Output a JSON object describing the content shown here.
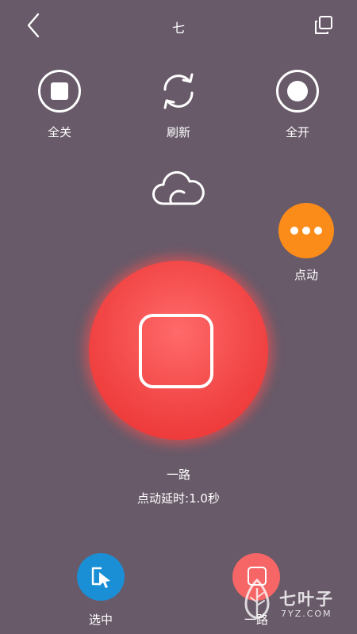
{
  "header": {
    "title": "七"
  },
  "toolbar": {
    "all_off_label": "全关",
    "refresh_label": "刷新",
    "all_on_label": "全开"
  },
  "jog": {
    "label": "点动"
  },
  "main": {
    "channel_name": "一路",
    "delay_text": "点动延时:1.0秒"
  },
  "bottom": {
    "select_label": "选中",
    "channel_label": "一路"
  },
  "watermark": {
    "brand": "七叶子",
    "domain": "7YZ.COM"
  },
  "colors": {
    "background": "#685a69",
    "accent_orange": "#fb8c1a",
    "main_red": "#f24646",
    "select_blue": "#1a8fd6",
    "channel_red": "#f66666"
  }
}
